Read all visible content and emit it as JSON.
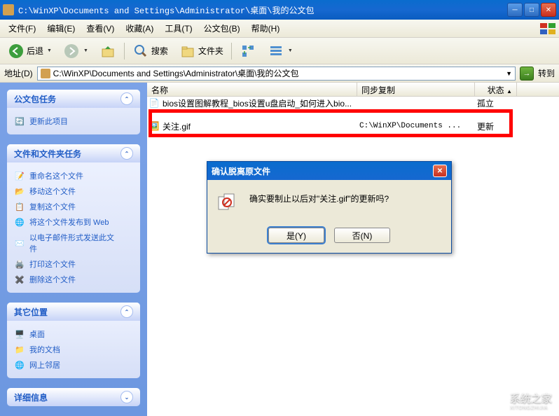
{
  "titlebar": {
    "title": "C:\\WinXP\\Documents and Settings\\Administrator\\桌面\\我的公文包"
  },
  "menubar": {
    "file": "文件(F)",
    "edit": "编辑(E)",
    "view": "查看(V)",
    "favorites": "收藏(A)",
    "tools": "工具(T)",
    "briefcase": "公文包(B)",
    "help": "帮助(H)"
  },
  "toolbar": {
    "back": "后退",
    "search": "搜索",
    "folders": "文件夹"
  },
  "addressbar": {
    "label": "地址(D)",
    "path": "C:\\WinXP\\Documents and Settings\\Administrator\\桌面\\我的公文包",
    "go": "转到"
  },
  "sidebar": {
    "panel1": {
      "title": "公文包任务",
      "items": [
        "更新此项目"
      ]
    },
    "panel2": {
      "title": "文件和文件夹任务",
      "items": [
        "重命名这个文件",
        "移动这个文件",
        "复制这个文件",
        "将这个文件发布到 Web",
        "以电子邮件形式发送此文件",
        "打印这个文件",
        "删除这个文件"
      ]
    },
    "panel3": {
      "title": "其它位置",
      "items": [
        "桌面",
        "我的文档",
        "网上邻居"
      ]
    },
    "panel4": {
      "title": "详细信息"
    }
  },
  "columns": {
    "name": "名称",
    "sync": "同步复制",
    "status": "状态"
  },
  "files": [
    {
      "name": "bios设置图解教程_bios设置u盘启动_如何进入bio...",
      "sync": "",
      "status": "孤立"
    },
    {
      "name": "关注.gif",
      "sync": "C:\\WinXP\\Documents ...",
      "status": "更新"
    }
  ],
  "dialog": {
    "title": "确认脱离原文件",
    "message": "确实要制止以后对\"关注.gif\"的更新吗?",
    "yes": "是(Y)",
    "no": "否(N)"
  },
  "watermark": {
    "text": "系统之家",
    "sub": "XITONGZHIJIA"
  }
}
